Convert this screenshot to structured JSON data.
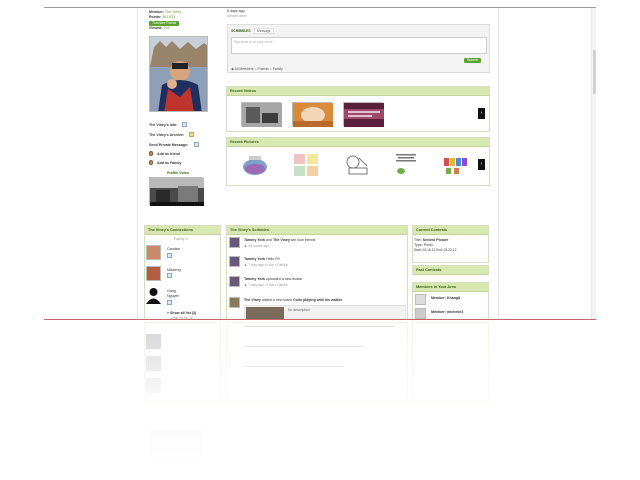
{
  "profile": {
    "member_label": "Member:",
    "member_value": "The Viney",
    "points_label": "Points:",
    "points_value": "581,833",
    "transfer_button": "Transfer Points",
    "viewed_label": "Viewed:",
    "viewed_value": "918",
    "info_link": "The Viney's Info:",
    "archive_link": "The Viney's Archive:",
    "private_message_link": "Send Private Message:",
    "add_friend": "Add as friend",
    "add_family": "Add as Family",
    "profile_video_label": "Profile Video"
  },
  "status": {
    "time_ago": "6 days ago",
    "status_text": "almost done"
  },
  "scribbles_box": {
    "tab_scribbles": "SCRIBBLES",
    "tab_message": "Message",
    "placeholder": "Say what is on your mind...",
    "radio_all": "All Members",
    "radio_friends": "Friends",
    "radio_family": "Family",
    "submit": "Submit"
  },
  "recent_videos": {
    "title": "Recent Videos",
    "next": "›"
  },
  "recent_pictures": {
    "title": "Recent Pictures",
    "next": "›"
  },
  "connections": {
    "title": "The Viney's Connections",
    "family_label": "Family 3",
    "members": [
      "Caroline",
      "Mikaeng",
      "Gang Nguyen"
    ],
    "show_all": "Show all list (3)",
    "post_link": "(post my pic 11)"
  },
  "scribbles_feed": {
    "title": "The Viney's Scribbles",
    "items": [
      {
        "name": "Tammy York",
        "mid": " and ",
        "name2": "The Viney",
        "text": " are now friends",
        "meta": "16 hours ago"
      },
      {
        "name": "Tammy York",
        "mid": "",
        "name2": "",
        "text": " Hello !!!!!",
        "meta": "7 day ago • Like • Dislike"
      },
      {
        "name": "Tammy York",
        "mid": "",
        "name2": "",
        "text": " uploaded a new avatar",
        "meta": "7 day ago • Like • Dislike"
      },
      {
        "name": "The Viney",
        "mid": "",
        "name2": "",
        "text": " added a new video ",
        "extra": "Colin playing with his walker",
        "meta": ""
      }
    ],
    "video_desc": "No description"
  },
  "contests": {
    "title": "Current Contests",
    "title_label": "Title:",
    "title_value": "Sexiest Picture",
    "type_label": "Type:",
    "type_value": "Photo",
    "dates": "Start: 03-15-12   End: 03-22-12"
  },
  "past_contests": {
    "title": "Past Contests"
  },
  "area_members": {
    "title": "Members in Your Area",
    "items": [
      {
        "label": "Member:",
        "name": "Khang8"
      },
      {
        "label": "Member:",
        "name": "michelle2"
      }
    ]
  }
}
